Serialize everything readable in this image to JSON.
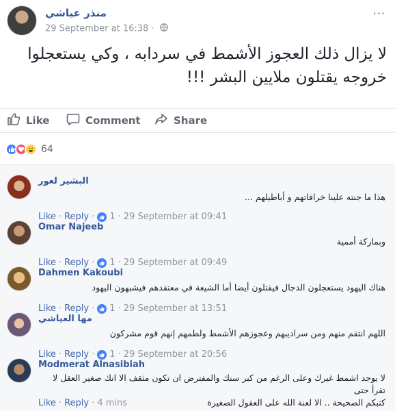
{
  "post": {
    "author": "منذر عياشي",
    "timestamp": "29 September at 16:38 ·",
    "options": "···",
    "text_line1": "لا يزال ذلك العجوز الأشمط في سردابه ، وكي يستعجلوا",
    "text_line2": "خروجه يقتلون ملايين البشر !!!"
  },
  "actions": {
    "like": "Like",
    "comment": "Comment",
    "share": "Share"
  },
  "reactions": {
    "count": "64",
    "icons": [
      "like-icon",
      "love-icon",
      "haha-icon"
    ]
  },
  "comments": [
    {
      "name": "البشير لعور",
      "text": "هذا ما جنته علينا خرافاتهم و أباطيلهم ...",
      "like": "Like",
      "reply": "Reply",
      "likes": "1",
      "time": "· 29 September at 09:41"
    },
    {
      "name": "Omar Najeeb",
      "text": "وبماركة أممية",
      "like": "Like",
      "reply": "Reply",
      "likes": "1",
      "time": "· 29 September at 09:49"
    },
    {
      "name": "Dahmen Kakoubi",
      "text": "هناك اليهود يستعجلون الدجال فيقتلون أيضا أما الشيعة في معتقدهم فيشبهون اليهود",
      "like": "Like",
      "reply": "Reply",
      "likes": "1",
      "time": "· 29 September at 13:51"
    },
    {
      "name": "مها العياشي",
      "text": "اللهم انتقم منهم ومن سراديبهم وعجوزهم الأشمط ولطمهم إنهم قوم مشركون",
      "like": "Like",
      "reply": "Reply",
      "likes": "1",
      "time": "· 29 September at 20:56"
    },
    {
      "name": "Modmerat Alnasibiah",
      "text_line1": "لا يوجد اشمط غيرك وعلى الرغم من كبر سنك والمفترض ان تكون مثقف الا انك صغير العقل لا تقرأ حتى",
      "text_line2": "كتبكم الصحيحة .. الا لعنة الله على العقول الصغيرة",
      "like": "Like",
      "reply": "Reply",
      "time": "· 4 mins"
    }
  ],
  "colors": {
    "link": "#365899",
    "meta": "#90949c",
    "action": "#4267b2",
    "like_blue": "#4080ff"
  }
}
